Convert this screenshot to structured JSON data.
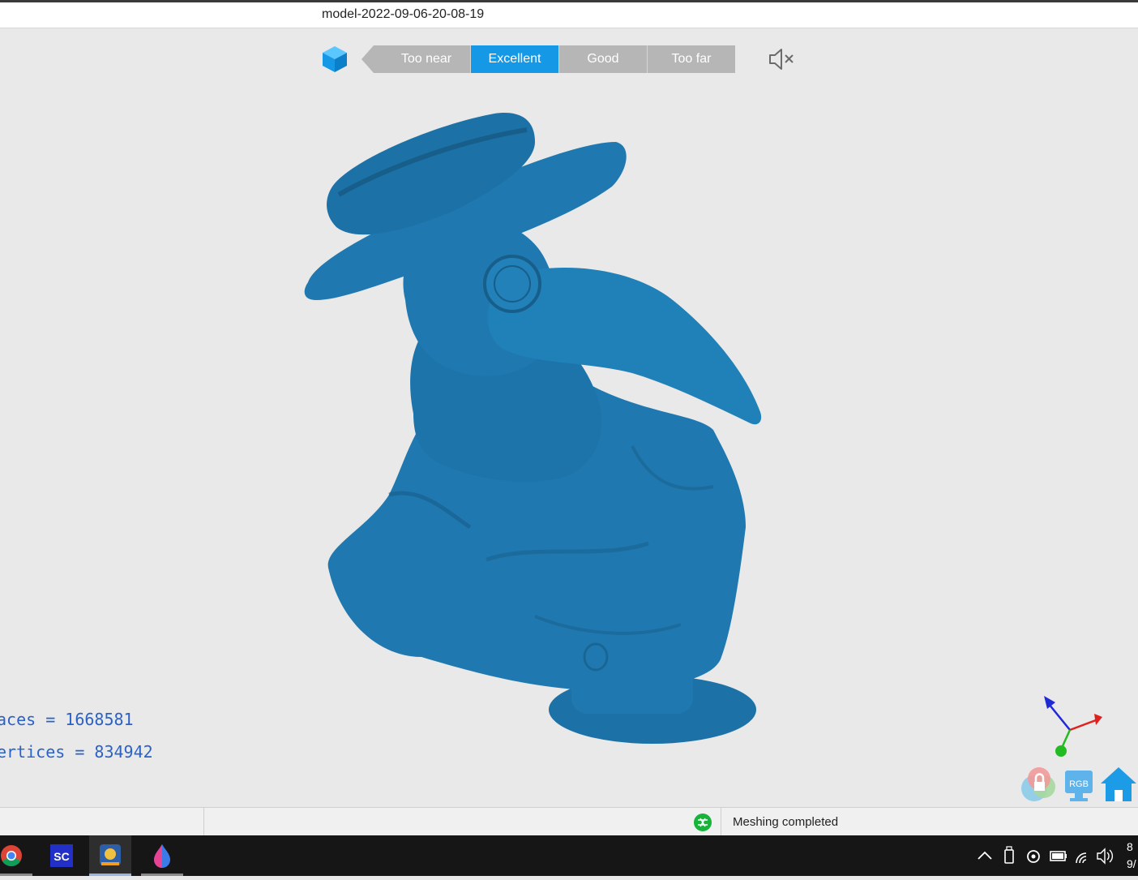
{
  "window": {
    "title": "model-2022-09-06-20-08-19"
  },
  "distance_indicator": {
    "segments": [
      {
        "label": "Too near",
        "active": false
      },
      {
        "label": "Excellent",
        "active": true
      },
      {
        "label": "Good",
        "active": false
      },
      {
        "label": "Too far",
        "active": false
      }
    ],
    "active_color": "#1598e6",
    "inactive_color": "#b6b6b6"
  },
  "icons": {
    "view_cube": "cube-icon",
    "sound": "speaker-muted-icon"
  },
  "model": {
    "color": "#1f79b0"
  },
  "stats": {
    "faces": "aces = 1668581",
    "vertices": "ertices = 834942"
  },
  "status": {
    "message": "Meshing completed"
  },
  "taskbar": {
    "apps": [
      "chrome-icon",
      "sc-app-icon",
      "scanner-app-icon",
      "color-drop-app-icon"
    ],
    "sc_label": "SC",
    "clock_time": "8",
    "clock_date": "9/"
  }
}
